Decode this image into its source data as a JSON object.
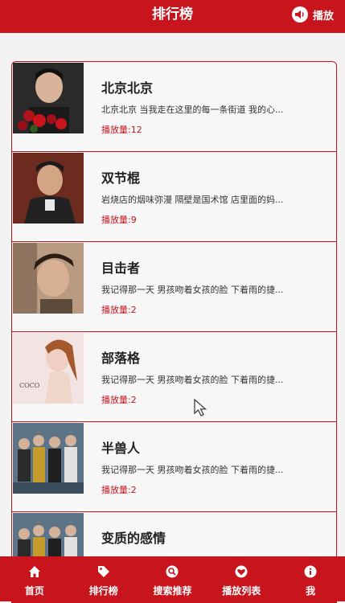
{
  "header": {
    "title": "排行榜",
    "play_label": "播放"
  },
  "songs": [
    {
      "title": "北京北京",
      "desc": "北京北京 当我走在这里的每一条街道 我的心...",
      "plays": "播放量:12"
    },
    {
      "title": "双节棍",
      "desc": "岩烧店的烟味弥漫 隔壁是国术馆 店里面的妈...",
      "plays": "播放量:9"
    },
    {
      "title": "目击者",
      "desc": "我记得那一天 男孩吻着女孩的脸 下着雨的捷...",
      "plays": "播放量:2"
    },
    {
      "title": "部落格",
      "desc": "我记得那一天 男孩吻着女孩的脸 下着雨的捷...",
      "plays": "播放量:2"
    },
    {
      "title": "半兽人",
      "desc": "我记得那一天 男孩吻着女孩的脸 下着雨的捷...",
      "plays": "播放量:2"
    },
    {
      "title": "变质的感情",
      "desc": "",
      "plays": ""
    }
  ],
  "album_art_text": "COCO",
  "nav": {
    "home": "首页",
    "ranking": "排行榜",
    "search": "搜索推荐",
    "playlist": "播放列表",
    "me": "我"
  },
  "colors": {
    "brand": "#c8141c",
    "background": "#f2f2f2"
  }
}
